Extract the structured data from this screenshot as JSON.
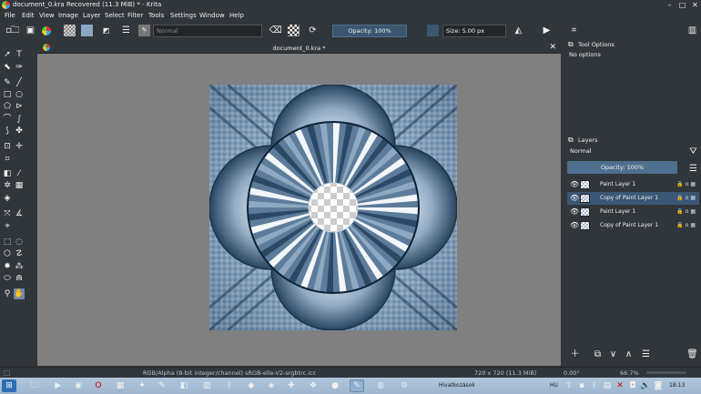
{
  "window": {
    "title": "document_0.kra Recovered  (11.3 MiB)  * - Krita",
    "controls": {
      "minimize": "–",
      "maximize": "□",
      "close": "✕"
    }
  },
  "menu": [
    "File",
    "Edit",
    "View",
    "Image",
    "Layer",
    "Select",
    "Filter",
    "Tools",
    "Settings",
    "Window",
    "Help"
  ],
  "toolbar": {
    "blend_mode": "Normal",
    "opacity_label": "Opacity: 100%",
    "size_label": "Size: 5.00 px"
  },
  "document": {
    "tab_title": "document_0.kra *"
  },
  "tool_options": {
    "title": "Tool Options",
    "content": "No options"
  },
  "layers": {
    "title": "Layers",
    "blend_mode": "Normal",
    "opacity_label": "Opacity:  100%",
    "items": [
      {
        "name": "Paint Layer 1",
        "selected": false
      },
      {
        "name": "Copy of Paint Layer 1",
        "selected": true
      },
      {
        "name": "Paint Layer 1",
        "selected": false
      },
      {
        "name": "Copy of Paint Layer 1",
        "selected": false
      }
    ]
  },
  "status": {
    "color_profile": "RGB/Alpha (8-bit integer/channel)  sRGB-elle-V2-srgbtrc.icc",
    "dimensions": "720 x 720 (11.3 MiB)",
    "rotation": "0.00°",
    "zoom": "66.7%"
  },
  "taskbar": {
    "language": "HU",
    "clock": "18:13",
    "hint": "Hivatkozások"
  },
  "colors": {
    "panel": "#31363b",
    "canvas": "#808080",
    "accent": "#3b5776",
    "taskbar": "#b0c6dc"
  }
}
